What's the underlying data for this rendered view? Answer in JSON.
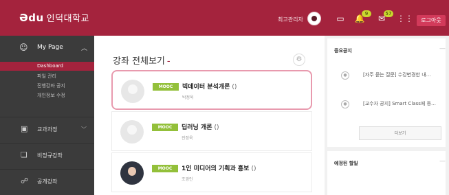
{
  "header": {
    "logo": "Ədu",
    "school": "인덕대학교",
    "admin_label": "최고관리자",
    "badges": [
      "9",
      "57"
    ],
    "logout_label": "로그아웃",
    "icons": [
      "avatar",
      "monitor-icon",
      "bell-icon",
      "mail-icon",
      "apps-grid-icon"
    ]
  },
  "sidebar": {
    "mypage": {
      "label": "My Page",
      "icon": "user-icon"
    },
    "sub_items": [
      {
        "label": "Dashboard",
        "active": true
      },
      {
        "label": "파일 관리"
      },
      {
        "label": "진행강좌 공지"
      },
      {
        "label": "개인정보 수정"
      }
    ],
    "items": [
      {
        "label": "교과과정",
        "icon": "book-icon"
      },
      {
        "label": "비정규강좌",
        "icon": "open-book-icon"
      },
      {
        "label": "공개강좌",
        "icon": "people-icon"
      }
    ]
  },
  "main": {
    "title": "강좌 전체보기",
    "title_suffix": "-",
    "courses": [
      {
        "tag": "MOOC",
        "title": "빅데이터 분석개론",
        "paren": "()",
        "instructor": "박정욱"
      },
      {
        "tag": "MOOC",
        "title": "딥러닝 개론",
        "paren": "()",
        "instructor": "진정욱"
      },
      {
        "tag": "MOOC",
        "title": "1인 미디어의 기획과 홍보",
        "paren": "()",
        "instructor": "조경인"
      }
    ]
  },
  "right": {
    "notice_panel": {
      "title": "중요공지",
      "items": [
        "[자주 묻는 질문] 수강변경한 내…",
        "[교수자 공지] Smart Class에 등…"
      ],
      "more_label": "더보기"
    },
    "schedule_panel": {
      "title": "예정된 할일"
    }
  },
  "colors": {
    "brand": "#a4233d",
    "mooc": "#93c03a",
    "sidebar": "#3b3b3b"
  }
}
